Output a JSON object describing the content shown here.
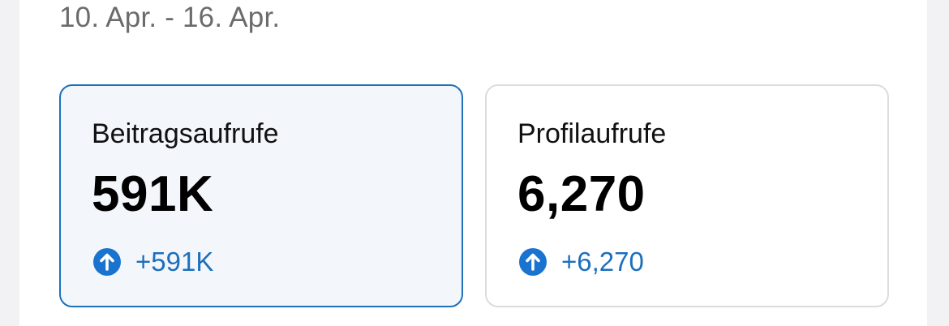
{
  "header": {
    "date_range": "10. Apr. - 16. Apr."
  },
  "cards": [
    {
      "title": "Beitragsaufrufe",
      "value": "591K",
      "change": "+591K",
      "trend_icon": "arrow-up-circle-icon",
      "selected": true
    },
    {
      "title": "Profilaufrufe",
      "value": "6,270",
      "change": "+6,270",
      "trend_icon": "arrow-up-circle-icon",
      "selected": false
    }
  ],
  "colors": {
    "accent": "#1e70b8",
    "positive_change": "#1c6fbd",
    "selected_card_bg": "#f3f6fb",
    "muted_text": "#6b6b6b"
  }
}
